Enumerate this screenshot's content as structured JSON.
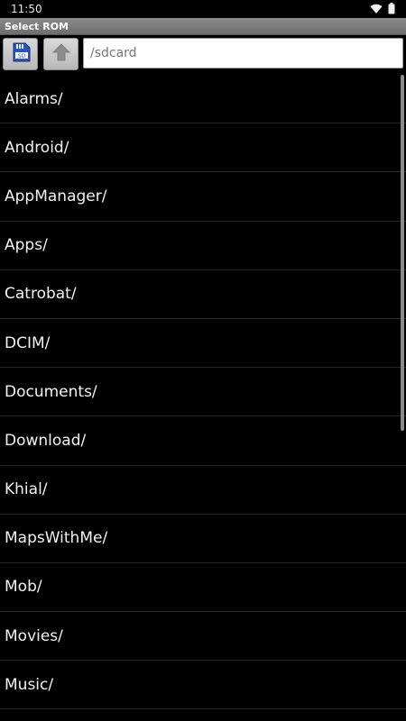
{
  "status_bar": {
    "time": "11:50",
    "icons": [
      "wifi-icon",
      "battery-icon"
    ]
  },
  "header": {
    "title": "Select ROM"
  },
  "toolbar": {
    "sdcard_button_icon": "sd-card-icon",
    "up_button_icon": "arrow-up-icon",
    "path_value": "/sdcard"
  },
  "file_list": {
    "items": [
      "Alarms/",
      "Android/",
      "AppManager/",
      "Apps/",
      "Catrobat/",
      "DCIM/",
      "Documents/",
      "Download/",
      "Khial/",
      "MapsWithMe/",
      "Mob/",
      "Movies/",
      "Music/"
    ]
  },
  "colors": {
    "background": "#000000",
    "titlebar": "#7c7c7c",
    "text": "#f2f2f2",
    "divider": "#262626"
  }
}
